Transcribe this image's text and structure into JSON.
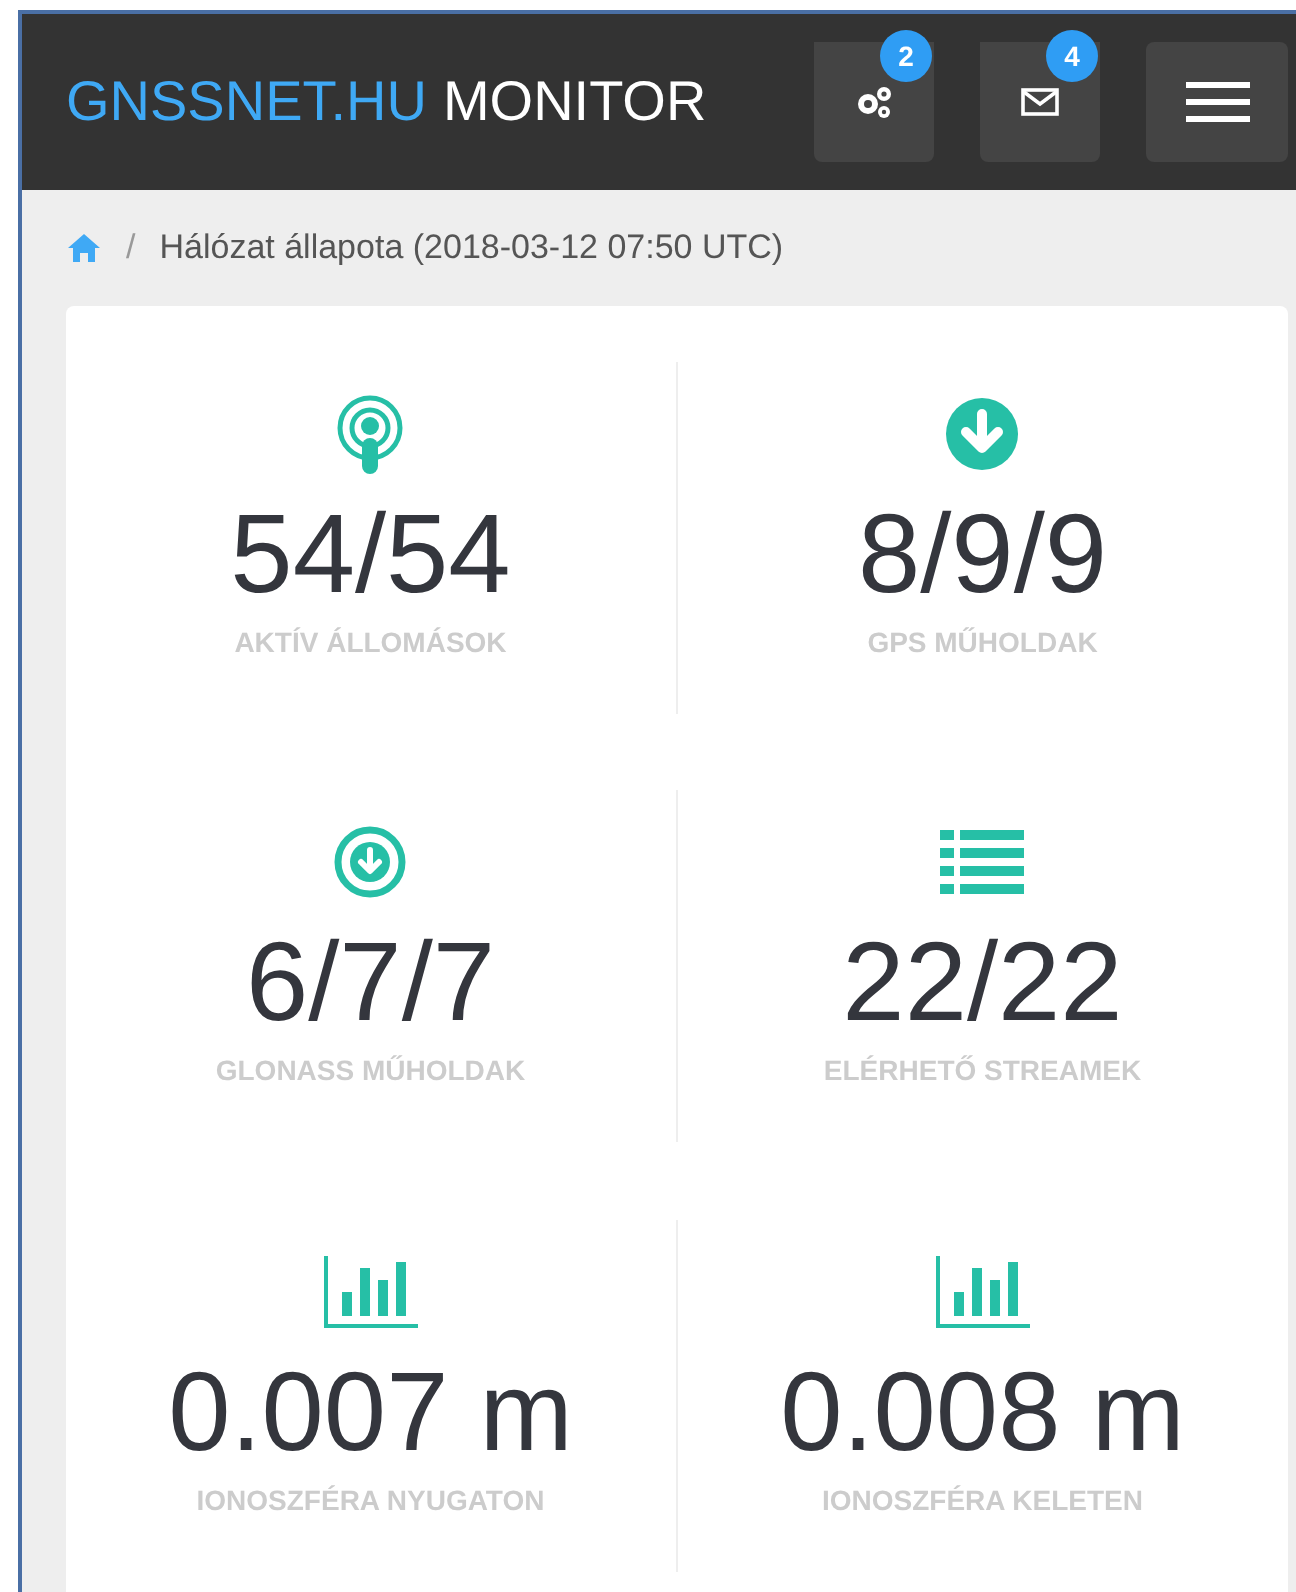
{
  "header": {
    "brand": "GNSSNET.HU",
    "brand_suffix": "MONITOR",
    "buttons": [
      {
        "badge": "2"
      },
      {
        "badge": "4"
      }
    ]
  },
  "breadcrumb": {
    "separator": "/",
    "current": "Hálózat állapota (2018-03-12 07:50 UTC)"
  },
  "stats": [
    {
      "value": "54/54",
      "label": "AKTÍV ÁLLOMÁSOK"
    },
    {
      "value": "8/9/9",
      "label": "GPS MŰHOLDAK"
    },
    {
      "value": "6/7/7",
      "label": "GLONASS MŰHOLDAK"
    },
    {
      "value": "22/22",
      "label": "ELÉRHETŐ STREAMEK"
    },
    {
      "value": "0.007 m",
      "label": "IONOSZFÉRA NYUGATON"
    },
    {
      "value": "0.008 m",
      "label": "IONOSZFÉRA KELETEN"
    }
  ]
}
